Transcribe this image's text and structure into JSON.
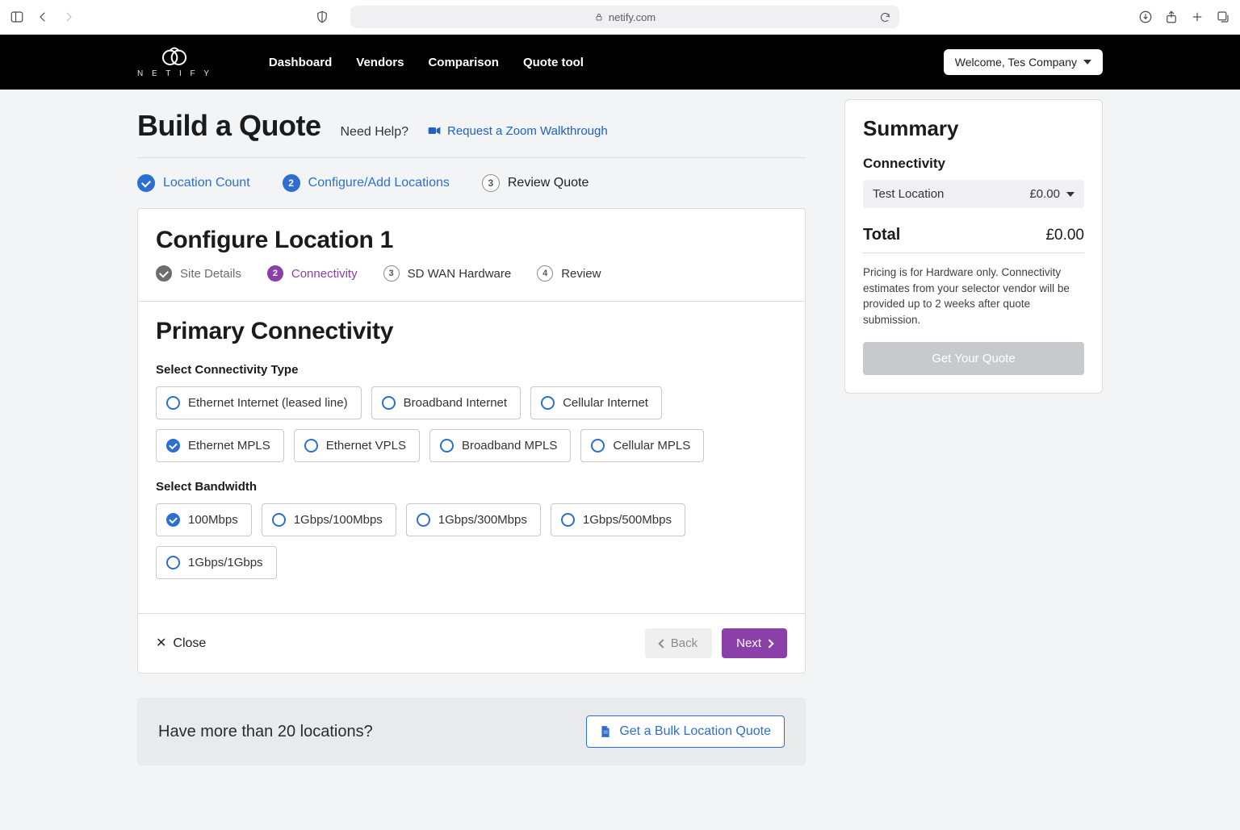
{
  "browser": {
    "domain": "netify.com"
  },
  "header": {
    "brand": "N E T I F Y",
    "nav": [
      "Dashboard",
      "Vendors",
      "Comparison",
      "Quote tool"
    ],
    "welcome": "Welcome, Tes Company"
  },
  "page": {
    "title": "Build a Quote",
    "need_help": "Need Help?",
    "zoom_link": "Request a Zoom Walkthrough"
  },
  "stepper": [
    {
      "label": "Location Count",
      "state": "done"
    },
    {
      "num": "2",
      "label": "Configure/Add Locations",
      "state": "active"
    },
    {
      "num": "3",
      "label": "Review Quote",
      "state": "pending"
    }
  ],
  "card": {
    "title": "Configure Location 1",
    "steps": [
      {
        "label": "Site Details",
        "state": "done"
      },
      {
        "num": "2",
        "label": "Connectivity",
        "state": "active"
      },
      {
        "num": "3",
        "label": "SD WAN Hardware",
        "state": "pending"
      },
      {
        "num": "4",
        "label": "Review",
        "state": "pending"
      }
    ],
    "section_title": "Primary Connectivity",
    "conn_label": "Select Connectivity Type",
    "conn_options": [
      {
        "label": "Ethernet Internet (leased line)",
        "selected": false
      },
      {
        "label": "Broadband Internet",
        "selected": false
      },
      {
        "label": "Cellular Internet",
        "selected": false
      },
      {
        "label": "Ethernet MPLS",
        "selected": true
      },
      {
        "label": "Ethernet VPLS",
        "selected": false
      },
      {
        "label": "Broadband MPLS",
        "selected": false
      },
      {
        "label": "Cellular MPLS",
        "selected": false
      }
    ],
    "bw_label": "Select Bandwidth",
    "bw_options": [
      {
        "label": "100Mbps",
        "selected": true
      },
      {
        "label": "1Gbps/100Mbps",
        "selected": false
      },
      {
        "label": "1Gbps/300Mbps",
        "selected": false
      },
      {
        "label": "1Gbps/500Mbps",
        "selected": false
      },
      {
        "label": "1Gbps/1Gbps",
        "selected": false
      }
    ],
    "close": "Close",
    "back": "Back",
    "next": "Next"
  },
  "bulk": {
    "question": "Have more than 20 locations?",
    "cta": "Get a Bulk Location Quote"
  },
  "summary": {
    "title": "Summary",
    "subtitle": "Connectivity",
    "row_label": "Test Location",
    "row_value": "£0.00",
    "total_label": "Total",
    "total_value": "£0.00",
    "note": "Pricing is for Hardware only. Connectivity estimates from your selector vendor will be provided up to 2 weeks after quote submission.",
    "cta": "Get Your Quote"
  }
}
